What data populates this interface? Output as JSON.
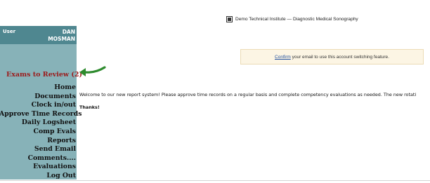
{
  "header": {
    "logo_icon": "institute-logo-icon",
    "title": "Demo Technical Institute — Diagnostic Medical Sonography"
  },
  "user": {
    "label": "User",
    "first_name": "DAN",
    "last_name": "MOSMAN"
  },
  "sidebar": {
    "exams_to_review": "Exams to Review (2)",
    "arrow_icon": "green-arrow-icon",
    "items": [
      {
        "label": "Home"
      },
      {
        "label": "Documents"
      },
      {
        "label": "Clock in/out"
      },
      {
        "label": "Approve Time Records"
      },
      {
        "label": "Daily Logsheet"
      },
      {
        "label": "Comp Evals"
      },
      {
        "label": "Reports"
      },
      {
        "label": "Send Email"
      },
      {
        "label": "Comments...."
      },
      {
        "label": "Evaluations"
      },
      {
        "label": "Log Out"
      }
    ]
  },
  "notice": {
    "link_text": "Confirm",
    "message": " your email to use this account switching feature."
  },
  "main": {
    "welcome": "Welcome to our new report system! Please approve time records on a regular basis and complete competency evaluations as needed. The new rotati",
    "thanks": "Thanks!"
  },
  "colors": {
    "sidebar_bg": "#87b2b8",
    "user_bg": "#4f8790",
    "exams_link": "#9b1a1a",
    "arrow": "#2e8b2e",
    "notice_bg": "#fcf5e4",
    "notice_link": "#1f4e9c"
  }
}
